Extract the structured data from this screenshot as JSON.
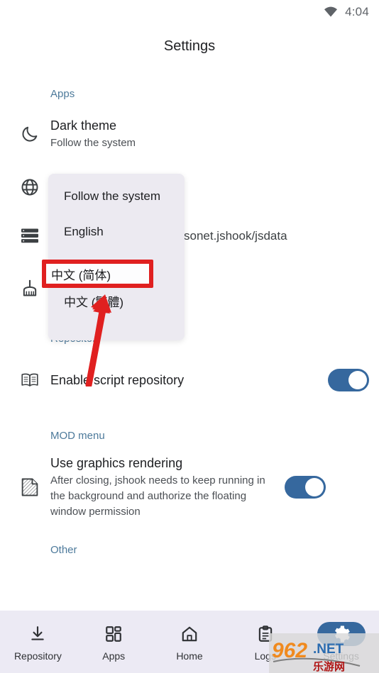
{
  "statusbar": {
    "wifi_icon": "wifi-icon",
    "time": "4:04"
  },
  "appbar": {
    "title": "Settings"
  },
  "sections": {
    "apps": {
      "header": "Apps"
    },
    "repository": {
      "header": "Repository"
    },
    "mod_menu": {
      "header": "MOD menu"
    },
    "other": {
      "header": "Other"
    }
  },
  "rows": {
    "dark_theme": {
      "icon": "moon-icon",
      "title": "Dark theme",
      "subtitle": "Follow the system"
    },
    "language": {
      "icon": "globe-icon",
      "title": "",
      "subtitle": ""
    },
    "data_path": {
      "icon": "storage-icon",
      "subtitle": "sonet.jshook/jsdata"
    },
    "clean": {
      "icon": "broom-icon"
    },
    "enable_script_repository": {
      "icon": "open-book-icon",
      "title": "Enable script repository",
      "toggle_state": "on"
    },
    "use_graphics_rendering": {
      "icon": "graphics-page-icon",
      "title": "Use graphics rendering",
      "subtitle": "After closing, jshook needs to keep running in the background and authorize the floating window permission",
      "toggle_state": "on"
    }
  },
  "language_dropdown": {
    "items": [
      {
        "label": "Follow the system",
        "highlighted": false
      },
      {
        "label": "English",
        "highlighted": false
      },
      {
        "label": "中文 (简体)",
        "highlighted": true
      },
      {
        "label": "中文 (繁體)",
        "highlighted": false
      }
    ]
  },
  "annotation": {
    "highlight_label": "中文 (简体)",
    "highlight_color": "#e02020",
    "arrow_color": "#e02020"
  },
  "bottom_nav": {
    "items": [
      {
        "label": "Repository",
        "icon": "download-icon",
        "active": false
      },
      {
        "label": "Apps",
        "icon": "grid-icon",
        "active": false
      },
      {
        "label": "Home",
        "icon": "home-icon",
        "active": false
      },
      {
        "label": "Logs",
        "icon": "clipboard-icon",
        "active": false
      },
      {
        "label": "Settings",
        "icon": "gear-icon",
        "active": true
      }
    ]
  },
  "watermark": {
    "text_962": "962",
    "text_net": ".NET",
    "text_cn": "乐游网"
  },
  "colors": {
    "accent_blue": "#36689e",
    "section_header": "#4d7a9b",
    "nav_background": "#eceaf4",
    "dropdown_background": "#eceaf1",
    "annotation_red": "#e02020"
  }
}
